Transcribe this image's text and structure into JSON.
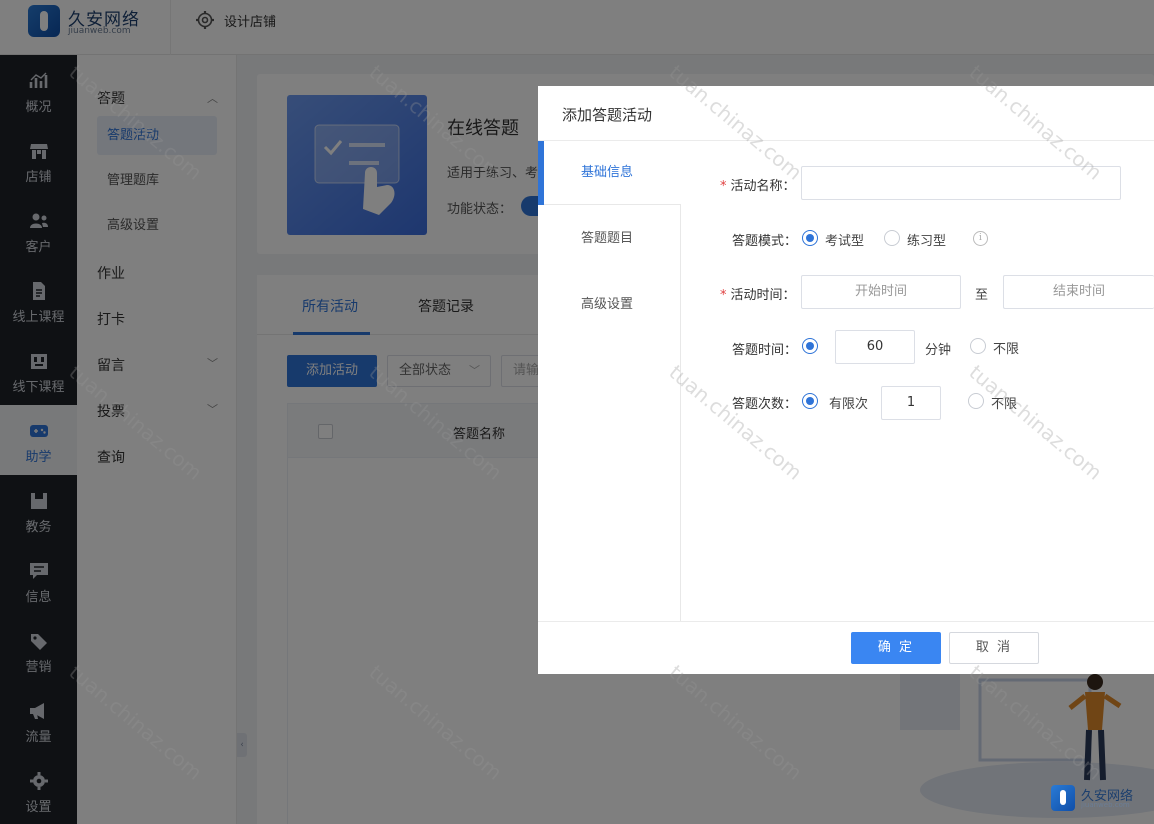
{
  "brand": {
    "name": "久安网络",
    "domain": "jiuanweb.com"
  },
  "topbar": {
    "design_store": "设计店铺"
  },
  "sidenav": {
    "items": [
      {
        "label": "概况",
        "icon": "chart-icon"
      },
      {
        "label": "店铺",
        "icon": "store-icon"
      },
      {
        "label": "客户",
        "icon": "users-icon"
      },
      {
        "label": "线上课程",
        "icon": "document-icon"
      },
      {
        "label": "线下课程",
        "icon": "classroom-icon"
      },
      {
        "label": "助学",
        "icon": "gamepad-icon",
        "active": true
      },
      {
        "label": "教务",
        "icon": "book-icon"
      },
      {
        "label": "信息",
        "icon": "message-icon"
      },
      {
        "label": "营销",
        "icon": "tag-icon"
      },
      {
        "label": "流量",
        "icon": "megaphone-icon"
      },
      {
        "label": "设置",
        "icon": "gear-icon"
      }
    ]
  },
  "subnav": {
    "group_quiz": "答题",
    "quiz_items": [
      "答题活动",
      "管理题库",
      "高级设置"
    ],
    "homework": "作业",
    "checkin": "打卡",
    "message": "留言",
    "vote": "投票",
    "query": "查询"
  },
  "banner": {
    "title": "在线答题",
    "desc": "适用于练习、考",
    "status_label": "功能状态："
  },
  "list": {
    "tabs": [
      "所有活动",
      "答题记录"
    ],
    "add_button": "添加活动",
    "status_select": "全部状态",
    "search_placeholder": "请输",
    "col_name": "答题名称"
  },
  "dialog": {
    "title": "添加答题活动",
    "tabs": [
      "基础信息",
      "答题题目",
      "高级设置"
    ],
    "form": {
      "name_label": "活动名称：",
      "name_value": "",
      "mode_label": "答题模式：",
      "mode_options": [
        "考试型",
        "练习型"
      ],
      "mode_selected": "考试型",
      "time_label": "活动时间：",
      "start_placeholder": "开始时间",
      "to_text": "至",
      "end_placeholder": "结束时间",
      "duration_label": "答题时间：",
      "duration_value": "60",
      "duration_unit": "分钟",
      "duration_unlimited": "不限",
      "attempts_label": "答题次数：",
      "attempts_limited": "有限次",
      "attempts_value": "1",
      "attempts_unlimited": "不限"
    },
    "ok": "确 定",
    "cancel": "取 消"
  },
  "watermark": "tuan.chinaz.com"
}
